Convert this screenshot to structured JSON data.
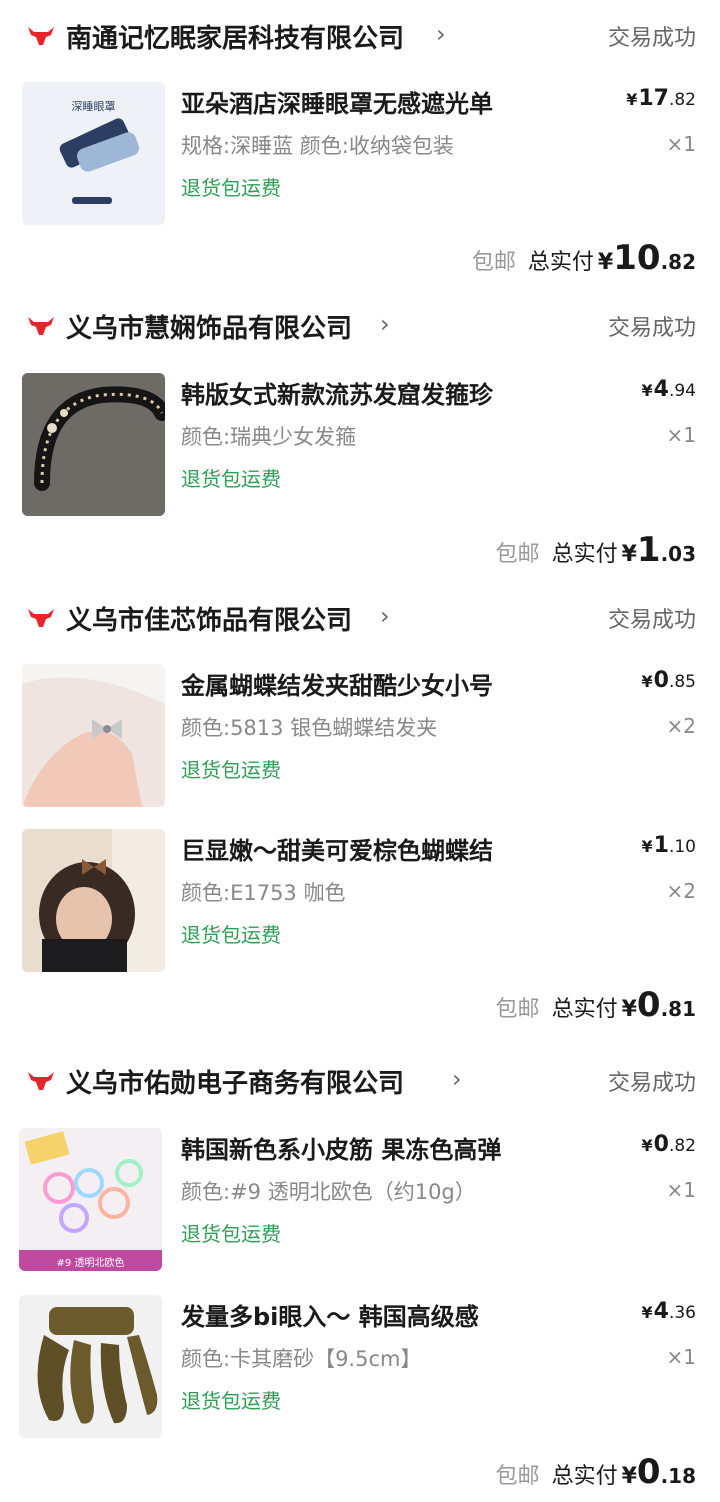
{
  "orders": [
    {
      "store": "南通记忆眠家居科技有限公司",
      "status": "交易成功",
      "items": [
        {
          "title": "亚朵酒店深睡眼罩无感遮光单",
          "spec": "规格:深睡蓝 颜色:收纳袋包装",
          "tag": "退货包运费",
          "price_int": "17",
          "price_dec": ".82",
          "qty": "×1",
          "thumb_text": "深睡眼罩"
        }
      ],
      "shipping": "包邮",
      "total_label": "总实付",
      "total_int": "10",
      "total_dec": ".82"
    },
    {
      "store": "义乌市慧娴饰品有限公司",
      "status": "交易成功",
      "items": [
        {
          "title": "韩版女式新款流苏发窟发箍珍",
          "spec": "颜色:瑞典少女发箍",
          "tag": "退货包运费",
          "price_int": "4",
          "price_dec": ".94",
          "qty": "×1"
        }
      ],
      "shipping": "包邮",
      "total_label": "总实付",
      "total_int": "1",
      "total_dec": ".03"
    },
    {
      "store": "义乌市佳芯饰品有限公司",
      "status": "交易成功",
      "items": [
        {
          "title": "金属蝴蝶结发夹甜酷少女小号",
          "spec": "颜色:5813 银色蝴蝶结发夹",
          "tag": "退货包运费",
          "price_int": "0",
          "price_dec": ".85",
          "qty": "×2"
        },
        {
          "title": "巨显嫩～甜美可爱棕色蝴蝶结",
          "spec": "颜色:E1753 咖色",
          "tag": "退货包运费",
          "price_int": "1",
          "price_dec": ".10",
          "qty": "×2"
        }
      ],
      "shipping": "包邮",
      "total_label": "总实付",
      "total_int": "0",
      "total_dec": ".81"
    },
    {
      "store": "义乌市佑勋电子商务有限公司",
      "status": "交易成功",
      "items": [
        {
          "title": "韩国新色系小皮筋 果冻色高弹",
          "spec": "颜色:#9 透明北欧色（约10g）",
          "tag": "退货包运费",
          "price_int": "0",
          "price_dec": ".82",
          "qty": "×1",
          "thumb_text": "#9 透明北欧色"
        },
        {
          "title": "发量多bi眼入～ 韩国高级感",
          "spec": "颜色:卡其磨砂【9.5cm】",
          "tag": "退货包运费",
          "price_int": "4",
          "price_dec": ".36",
          "qty": "×1"
        }
      ],
      "shipping": "包邮",
      "total_label": "总实付",
      "total_int": "0",
      "total_dec": ".18"
    }
  ],
  "currency": "¥",
  "colors": {
    "logo": "#e8232a",
    "refund_tag": "#2f9e54",
    "status": "#666666"
  }
}
